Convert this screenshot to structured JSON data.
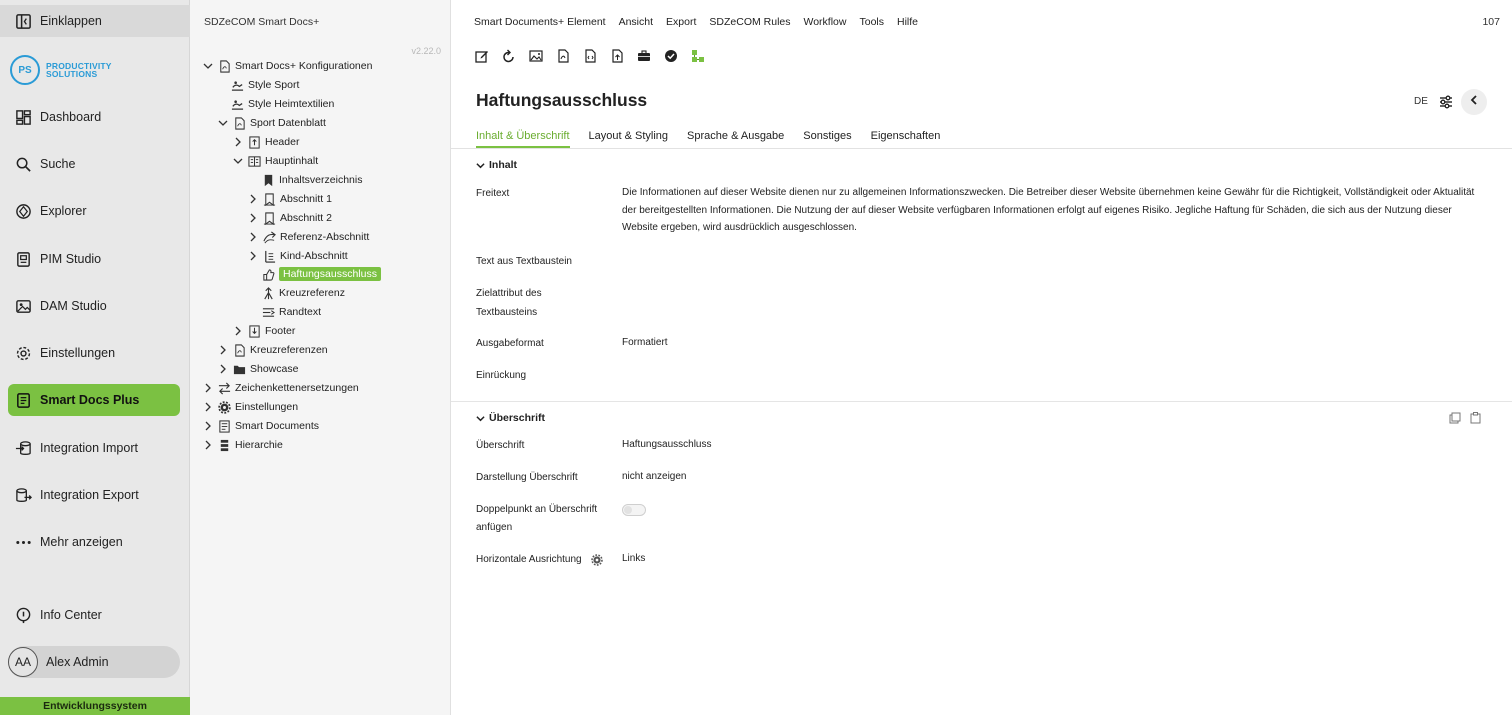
{
  "appnav": {
    "collapse_label": "Einklappen",
    "logo_initials": "PS",
    "logo_line1": "PRODUCTIVITY",
    "logo_line2": "SOLUTIONS",
    "items": [
      {
        "label": "Dashboard",
        "icon": "dashboard-icon"
      },
      {
        "label": "Suche",
        "icon": "search-icon"
      },
      {
        "label": "Explorer",
        "icon": "explorer-icon"
      },
      {
        "label": "PIM Studio",
        "icon": "pim-icon"
      },
      {
        "label": "DAM Studio",
        "icon": "image-icon"
      },
      {
        "label": "Einstellungen",
        "icon": "gear-icon"
      },
      {
        "label": "Smart Docs Plus",
        "icon": "document-icon"
      },
      {
        "label": "Integration Import",
        "icon": "import-icon"
      },
      {
        "label": "Integration Export",
        "icon": "export-icon"
      },
      {
        "label": "Mehr anzeigen",
        "icon": "more-icon"
      }
    ],
    "info_center": "Info Center",
    "user_initials": "AA",
    "user_name": "Alex Admin",
    "environment": "Entwicklungssystem",
    "accent_color": "#7bc142"
  },
  "tree": {
    "title": "SDZeCOM Smart Docs+",
    "version": "v2.22.0",
    "nodes": [
      {
        "label": "Smart Docs+ Konfigurationen",
        "icon": "pdf-icon"
      },
      {
        "label": "Style Sport",
        "icon": "style-icon"
      },
      {
        "label": "Style Heimtextilien",
        "icon": "style-icon"
      },
      {
        "label": "Sport Datenblatt",
        "icon": "pdf-icon"
      },
      {
        "label": "Header",
        "icon": "header-icon"
      },
      {
        "label": "Hauptinhalt",
        "icon": "book-icon"
      },
      {
        "label": "Inhaltsverzeichnis",
        "icon": "bookmark-icon"
      },
      {
        "label": "Abschnitt 1",
        "icon": "section-icon"
      },
      {
        "label": "Abschnitt 2",
        "icon": "section-icon"
      },
      {
        "label": "Referenz-Abschnitt",
        "icon": "reference-icon"
      },
      {
        "label": "Kind-Abschnitt",
        "icon": "child-icon"
      },
      {
        "label": "Haftungsausschluss",
        "icon": "disclaimer-icon"
      },
      {
        "label": "Kreuzreferenz",
        "icon": "crossref-icon"
      },
      {
        "label": "Randtext",
        "icon": "margin-icon"
      },
      {
        "label": "Footer",
        "icon": "footer-icon"
      },
      {
        "label": "Kreuzreferenzen",
        "icon": "pdf-icon"
      },
      {
        "label": "Showcase",
        "icon": "folder-icon"
      },
      {
        "label": "Zeichenkettenersetzungen",
        "icon": "swap-icon"
      },
      {
        "label": "Einstellungen",
        "icon": "gear-icon"
      },
      {
        "label": "Smart Documents",
        "icon": "docs-icon"
      },
      {
        "label": "Hierarchie",
        "icon": "hierarchy-icon"
      }
    ]
  },
  "menubar": {
    "items": [
      "Smart Documents+ Element",
      "Ansicht",
      "Export",
      "SDZeCOM Rules",
      "Workflow",
      "Tools",
      "Hilfe"
    ],
    "count": "107"
  },
  "main": {
    "title": "Haftungsausschluss",
    "language": "DE",
    "tabs": [
      "Inhalt & Überschrift",
      "Layout & Styling",
      "Sprache & Ausgabe",
      "Sonstiges",
      "Eigenschaften"
    ],
    "section_inhalt": {
      "title": "Inhalt",
      "freitext_label": "Freitext",
      "freitext_value": "Die Informationen auf dieser Website dienen nur zu allgemeinen Informationszwecken. Die Betreiber dieser Website übernehmen keine Gewähr für die Richtigkeit, Vollständigkeit oder Aktualität der bereitgestellten Informationen. Die Nutzung der auf dieser Website verfügbaren Informationen erfolgt auf eigenes Risiko. Jegliche Haftung für Schäden, die sich aus der Nutzung dieser Website ergeben, wird ausdrücklich ausgeschlossen.",
      "textbaustein_label": "Text aus Textbaustein",
      "zielattribut_label_1": "Zielattribut des",
      "zielattribut_label_2": "Textbausteins",
      "ausgabeformat_label": "Ausgabeformat",
      "ausgabeformat_value": "Formatiert",
      "einrueckung_label": "Einrückung"
    },
    "section_ueberschrift": {
      "title": "Überschrift",
      "ueberschrift_label": "Überschrift",
      "ueberschrift_value": "Haftungsausschluss",
      "darstellung_label": "Darstellung Überschrift",
      "darstellung_value": "nicht anzeigen",
      "doppelpunkt_label_1": "Doppelpunkt an Überschrift",
      "doppelpunkt_label_2": "anfügen",
      "doppelpunkt_enabled": false,
      "ausrichtung_label": "Horizontale Ausrichtung",
      "ausrichtung_value": "Links"
    }
  }
}
